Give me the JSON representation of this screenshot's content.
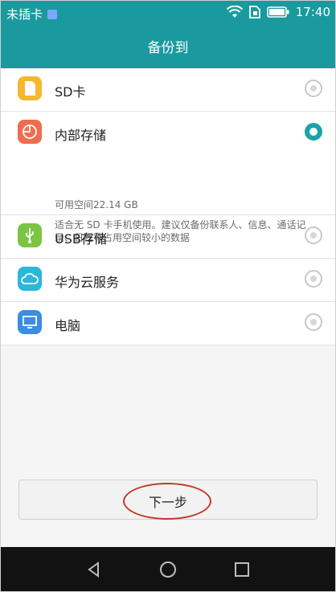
{
  "status_bar": {
    "carrier": "未插卡",
    "time": "17:40",
    "icons": [
      "sim-icon",
      "wifi-icon",
      "sim-card-icon",
      "battery-icon"
    ]
  },
  "header": {
    "title": "备份到"
  },
  "options": [
    {
      "label": "SD卡",
      "icon": "sd-card-icon",
      "color": "#f5b82e",
      "selected": false
    },
    {
      "label": "内部存储",
      "icon": "pie-chart-icon",
      "color": "#ef6d4e",
      "selected": true,
      "free_space": "可用空间22.14 GB",
      "hint": "适合无 SD 卡手机使用。建议仅备份联系人、信息、通话记录、日程等占用空间较小的数据"
    },
    {
      "label": "USB存储",
      "icon": "usb-icon",
      "color": "#7cc443",
      "selected": false
    },
    {
      "label": "华为云服务",
      "icon": "cloud-icon",
      "color": "#29b8d8",
      "selected": false
    },
    {
      "label": "电脑",
      "icon": "computer-icon",
      "color": "#3a8de0",
      "selected": false
    }
  ],
  "footer": {
    "next_label": "下一步"
  },
  "navigation": {
    "back": "back-icon",
    "home": "home-icon",
    "recents": "recents-icon"
  },
  "colors": {
    "accent": "#1a9a9e",
    "radio_checked": "#1aa3a8",
    "annotation": "#c0392b"
  }
}
